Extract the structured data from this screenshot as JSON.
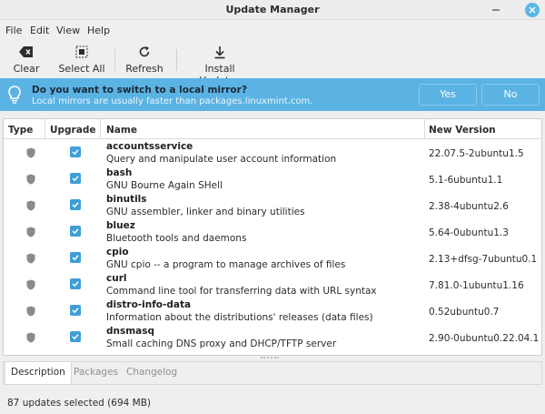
{
  "window": {
    "title": "Update Manager"
  },
  "menu": [
    "File",
    "Edit",
    "View",
    "Help"
  ],
  "toolbar": {
    "clear": "Clear",
    "select_all": "Select All",
    "refresh": "Refresh",
    "install": "Install Updates"
  },
  "infobar": {
    "question": "Do you want to switch to a local mirror?",
    "detail": "Local mirrors are usually faster than packages.linuxmint.com.",
    "yes": "Yes",
    "no": "No",
    "color": "#5bb3e4"
  },
  "table": {
    "headers": {
      "type": "Type",
      "upgrade": "Upgrade",
      "name": "Name",
      "version": "New Version"
    },
    "rows": [
      {
        "name": "accountsservice",
        "desc": "Query and manipulate user account information",
        "version": "22.07.5-2ubuntu1.5",
        "checked": true
      },
      {
        "name": "bash",
        "desc": "GNU Bourne Again SHell",
        "version": "5.1-6ubuntu1.1",
        "checked": true
      },
      {
        "name": "binutils",
        "desc": "GNU assembler, linker and binary utilities",
        "version": "2.38-4ubuntu2.6",
        "checked": true
      },
      {
        "name": "bluez",
        "desc": "Bluetooth tools and daemons",
        "version": "5.64-0ubuntu1.3",
        "checked": true
      },
      {
        "name": "cpio",
        "desc": "GNU cpio -- a program to manage archives of files",
        "version": "2.13+dfsg-7ubuntu0.1",
        "checked": true
      },
      {
        "name": "curl",
        "desc": "Command line tool for transferring data with URL syntax",
        "version": "7.81.0-1ubuntu1.16",
        "checked": true
      },
      {
        "name": "distro-info-data",
        "desc": "Information about the distributions' releases (data files)",
        "version": "0.52ubuntu0.7",
        "checked": true
      },
      {
        "name": "dnsmasq",
        "desc": "Small caching DNS proxy and DHCP/TFTP server",
        "version": "2.90-0ubuntu0.22.04.1",
        "checked": true
      }
    ]
  },
  "tabs": {
    "description": "Description",
    "packages": "Packages",
    "changelog": "Changelog"
  },
  "status": "87 updates selected (694 MB)"
}
